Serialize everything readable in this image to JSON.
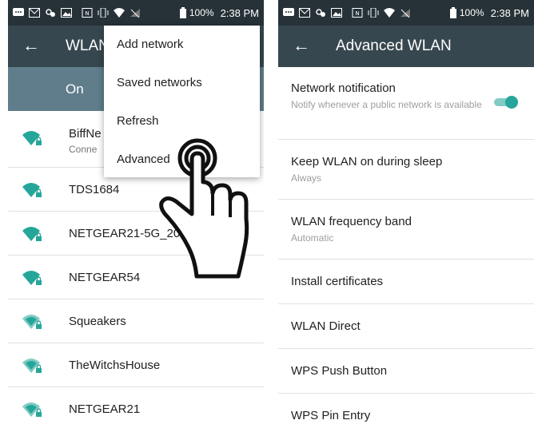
{
  "status": {
    "battery": "100%",
    "time": "2:38 PM"
  },
  "left": {
    "title": "WLAN",
    "on_label": "On",
    "networks": [
      {
        "name": "BiffNe",
        "subtitle": "Conne"
      },
      {
        "name": "TDS1684"
      },
      {
        "name": "NETGEAR21-5G_20"
      },
      {
        "name": "NETGEAR54"
      },
      {
        "name": "Squeakers"
      },
      {
        "name": "TheWitchsHouse"
      },
      {
        "name": "NETGEAR21"
      }
    ],
    "menu": [
      "Add network",
      "Saved networks",
      "Refresh",
      "Advanced"
    ]
  },
  "right": {
    "title": "Advanced WLAN",
    "settings": [
      {
        "title": "Network notification",
        "subtitle": "Notify whenever a public network is available",
        "toggle_on": true
      },
      {
        "title": "Keep WLAN on during sleep",
        "subtitle": "Always"
      },
      {
        "title": "WLAN frequency band",
        "subtitle": "Automatic"
      },
      {
        "title": "Install certificates"
      },
      {
        "title": "WLAN Direct"
      },
      {
        "title": "WPS Push Button"
      },
      {
        "title": "WPS Pin Entry"
      }
    ]
  },
  "colors": {
    "statusbar": "#263238",
    "appbar": "#37474f",
    "onbar": "#607d8b",
    "accent": "#26a69a",
    "wifi": "#26a69a"
  },
  "icons": [
    "message-icon",
    "gmail-icon",
    "sync-icon",
    "image-icon",
    "nfc-icon",
    "vibrate-icon",
    "wifi-icon",
    "no-signal-icon",
    "battery-icon",
    "back-arrow-icon",
    "wifi-lock-icon",
    "pointing-hand-icon",
    "toggle-switch"
  ]
}
